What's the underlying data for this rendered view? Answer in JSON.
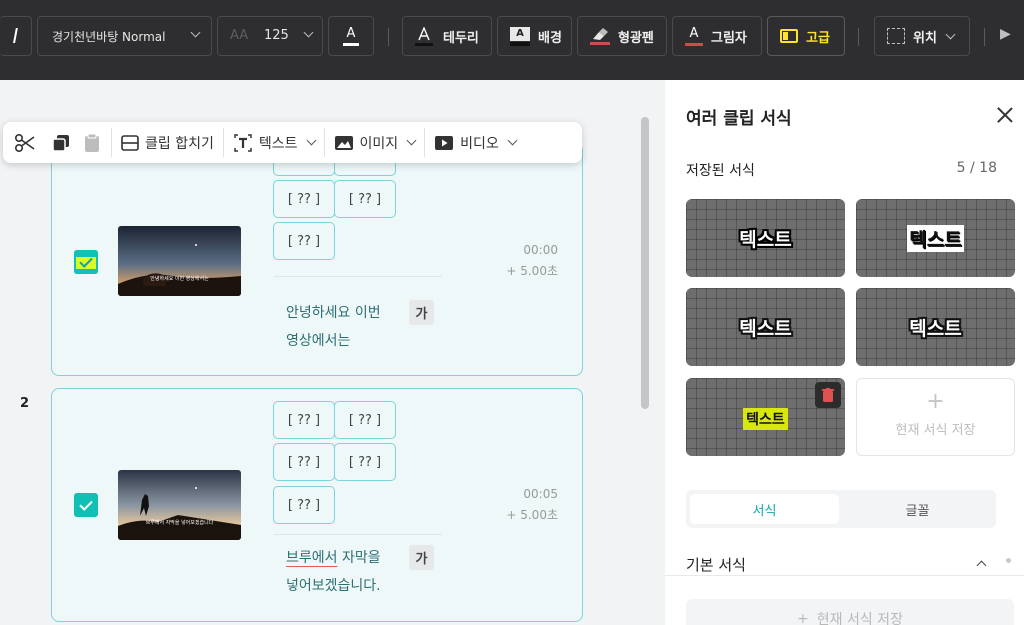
{
  "toolbar": {
    "font_name": "경기천년바탕 Normal",
    "font_size_icon": "AA",
    "font_size": "125",
    "color_label": "A",
    "outline_label": "테두리",
    "background_label": "배경",
    "highlight_label": "형광펜",
    "shadow_label": "그림자",
    "advanced_label": "고급",
    "position_label": "위치",
    "accent_color": "#ffe32b"
  },
  "floating_toolbar": {
    "merge_label": "클립 합치기",
    "text_label": "텍스트",
    "image_label": "이미지",
    "video_label": "비디오"
  },
  "clips": [
    {
      "number": "",
      "tags": [
        "[ ?? ]",
        "[ ?? ]",
        "[ ?? ]",
        "[ ?? ]",
        "[ ?? ]"
      ],
      "time_start": "00:00",
      "duration": "+ 5.00초",
      "line1": "안녕하세요 이번",
      "line2": "영상에서는",
      "ga": "가",
      "thumb_caption": "안녕하세요 이번 영상에서는"
    },
    {
      "number": "2",
      "tags": [
        "[ ?? ]",
        "[ ?? ]",
        "[ ?? ]",
        "[ ?? ]",
        "[ ?? ]"
      ],
      "time_start": "00:05",
      "duration": "+ 5.00초",
      "line1_part1": "브루에서",
      "line1_part2": " 자막을",
      "line2": "넣어보겠습니다.",
      "ga": "가",
      "thumb_caption": "브루에서 자막을 넣어보겠습니다"
    }
  ],
  "panel": {
    "title": "여러 클립 서식",
    "saved_label": "저장된 서식",
    "saved_count": "5 / 18",
    "style_cards": [
      "텍스트",
      "텍스트",
      "텍스트",
      "텍스트",
      "텍스트"
    ],
    "save_card_plus": "+",
    "save_card_label": "현재 서식 저장",
    "tab_format": "서식",
    "tab_font": "글꼴",
    "section_basic": "기본 서식",
    "save_current_plus": "+",
    "save_current_label": "현재 서식 저장"
  },
  "colors": {
    "teal": "#10a9b0",
    "checkbox": "#11c0b4",
    "highlight": "#d8ff1f"
  }
}
